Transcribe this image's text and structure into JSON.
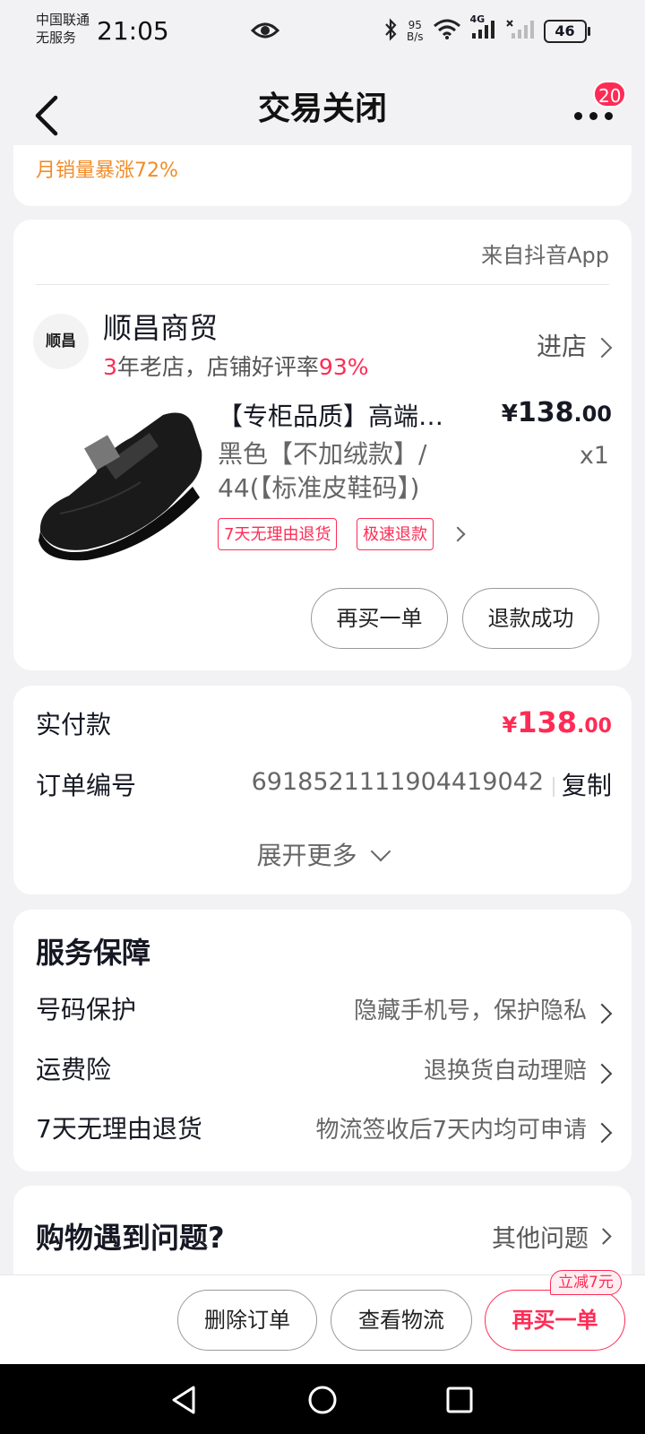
{
  "status_bar": {
    "carrier_line1": "中国联通",
    "carrier_line2": "无服务",
    "time": "21:05",
    "net_speed_value": "95",
    "net_speed_unit": "B/s",
    "network_label": "4G",
    "battery": "46"
  },
  "nav": {
    "title": "交易关闭",
    "badge_count": "20"
  },
  "promo": {
    "text": "月销量暴涨72%"
  },
  "order_card": {
    "source": "来自抖音App",
    "shop_logo_text": "顺昌",
    "shop_name": "顺昌商贸",
    "shop_years": "3",
    "shop_desc": "年老店，店铺好评率",
    "shop_rating": "93%",
    "enter_shop": "进店",
    "product_title": "【专柜品质】高端…",
    "price_symbol": "¥",
    "price_int": "138",
    "price_dec": ".00",
    "spec_line1": "黑色【不加绒款】/",
    "spec_line2": "44(【标准皮鞋码】)",
    "quantity": "x1",
    "tags": [
      "7天无理由退货",
      "极速退款"
    ],
    "btn_rebuy": "再买一单",
    "btn_refund": "退款成功"
  },
  "payment_card": {
    "paid_label": "实付款",
    "paid_symbol": "¥",
    "paid_int": "138",
    "paid_dec": ".00",
    "order_no_label": "订单编号",
    "order_no": "6918521111904419042",
    "copy": "复制",
    "expand": "展开更多"
  },
  "service_card": {
    "title": "服务保障",
    "rows": [
      {
        "label": "号码保护",
        "value": "隐藏手机号，保护隐私"
      },
      {
        "label": "运费险",
        "value": "退换货自动理赔"
      },
      {
        "label": "7天无理由退货",
        "value": "物流签收后7天内均可申请"
      }
    ]
  },
  "help_card": {
    "title": "购物遇到问题?",
    "other": "其他问题"
  },
  "bottom_bar": {
    "delete": "删除订单",
    "logistics": "查看物流",
    "rebuy": "再买一单",
    "discount_badge": "立减7元"
  }
}
